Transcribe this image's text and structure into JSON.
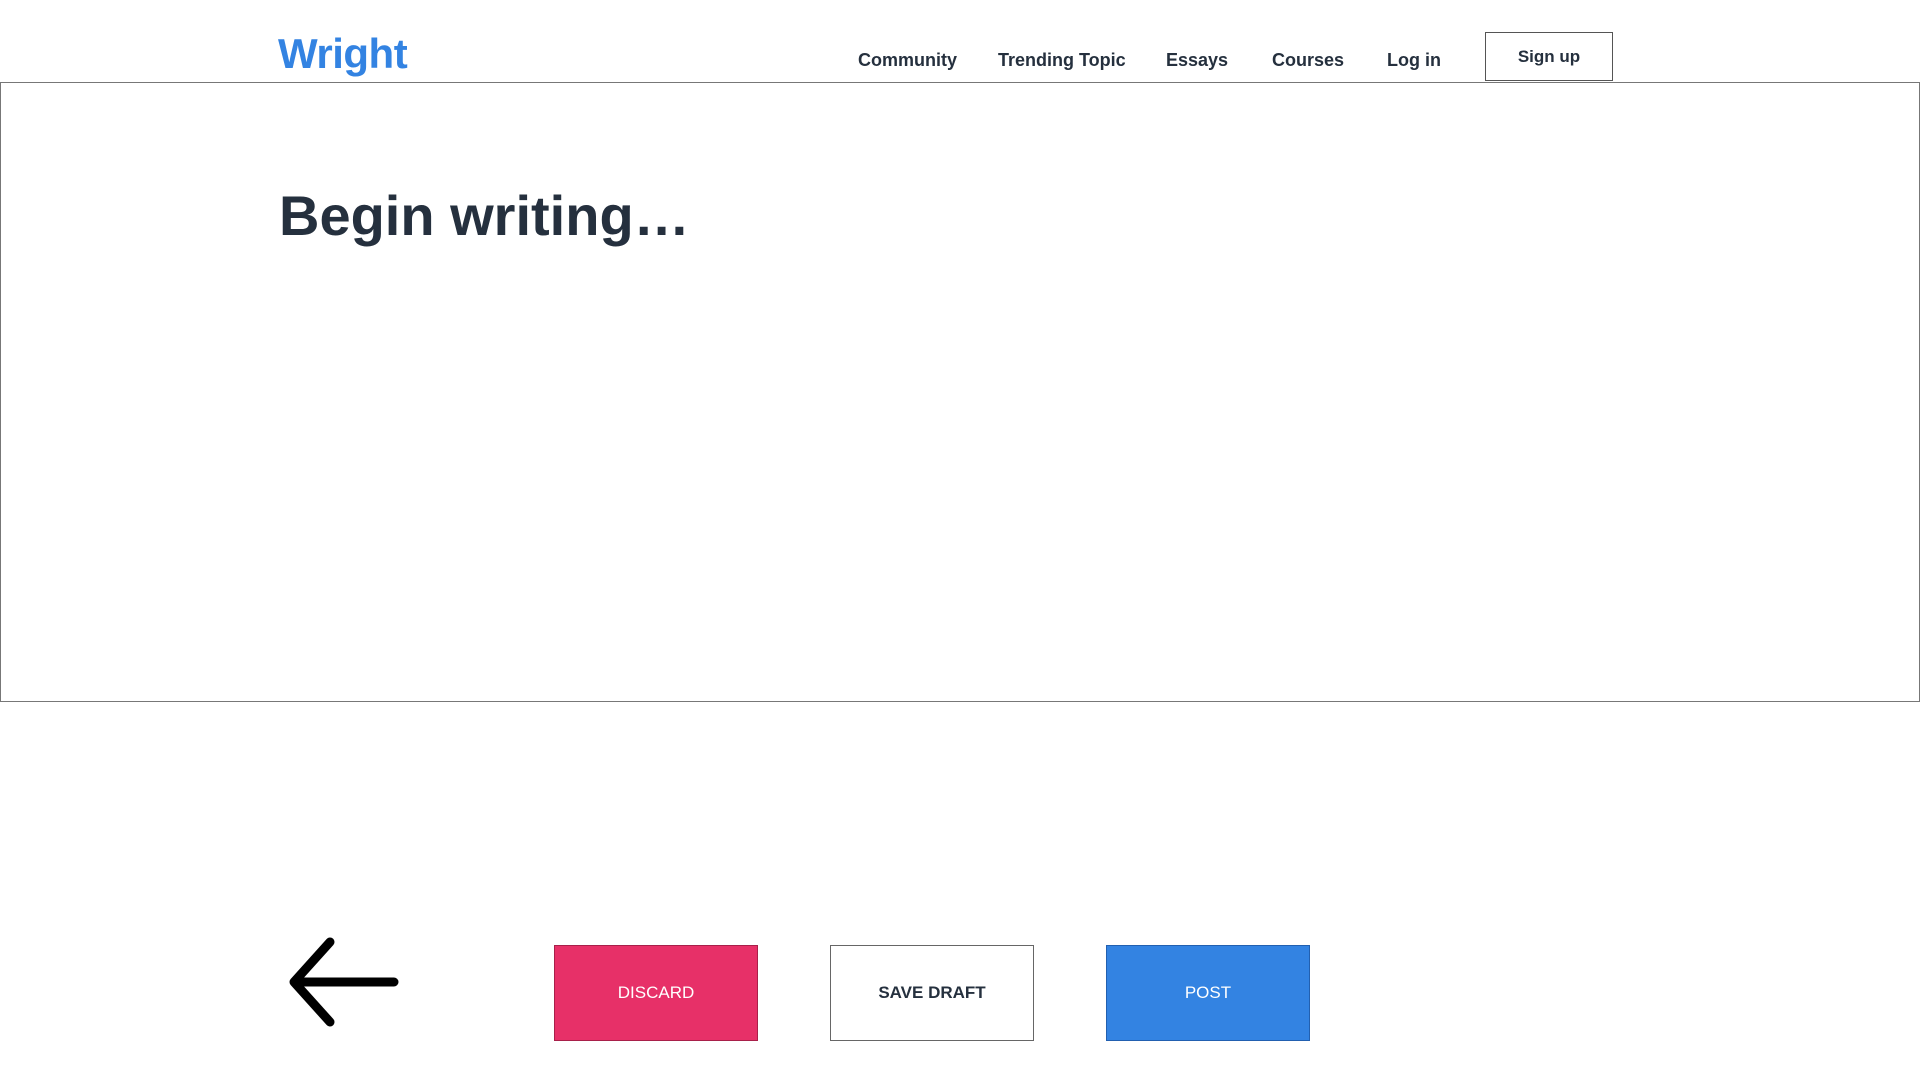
{
  "brand": {
    "logo_text": "Wright",
    "accent_color": "#3383e2"
  },
  "nav": {
    "items": [
      {
        "label": "Community"
      },
      {
        "label": "Trending Topic"
      },
      {
        "label": "Essays"
      },
      {
        "label": "Courses"
      },
      {
        "label": "Log in"
      }
    ],
    "signup_label": "Sign up"
  },
  "editor": {
    "placeholder": "Begin writing…"
  },
  "actions": {
    "back_icon": "arrow-left-icon",
    "discard_label": "DISCARD",
    "discard_color": "#e73068",
    "save_draft_label": "SAVE DRAFT",
    "post_label": "POST",
    "post_color": "#3383e2"
  }
}
